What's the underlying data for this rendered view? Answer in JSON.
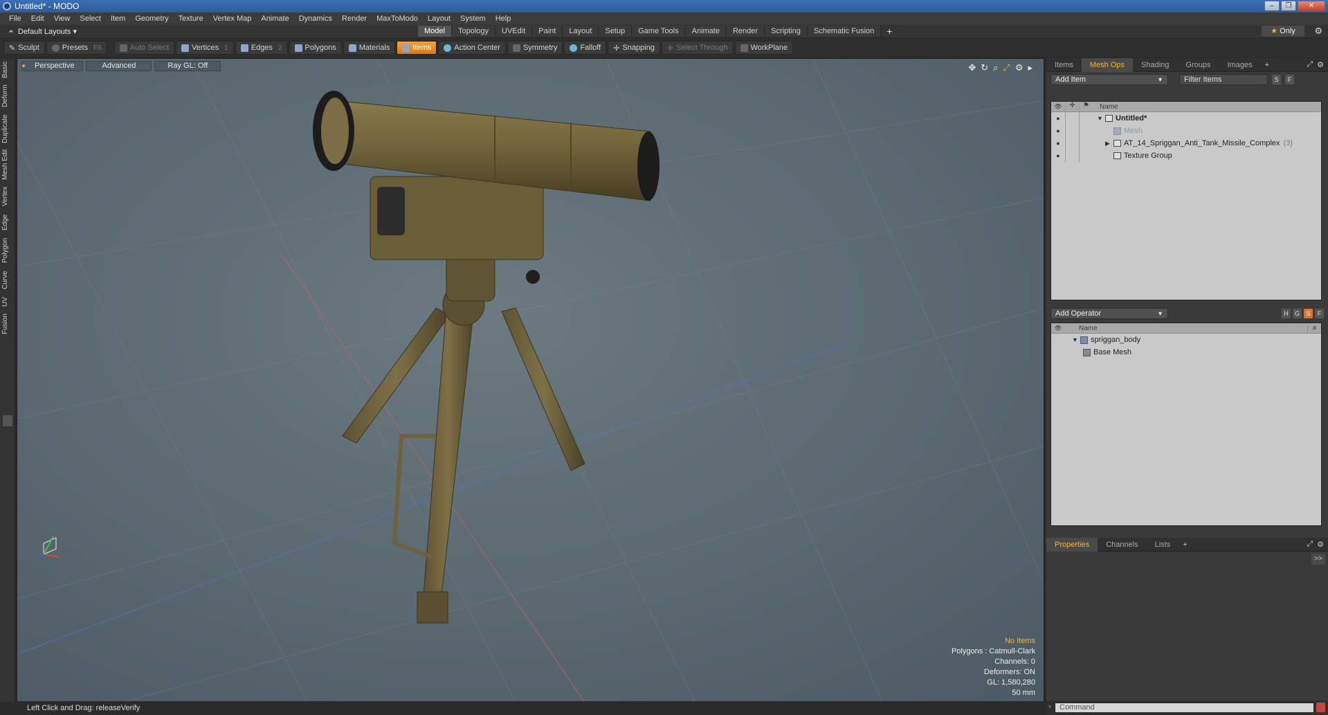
{
  "window": {
    "title": "Untitled* - MODO",
    "controls": [
      "–",
      "❐",
      "✕"
    ]
  },
  "menubar": [
    "File",
    "Edit",
    "View",
    "Select",
    "Item",
    "Geometry",
    "Texture",
    "Vertex Map",
    "Animate",
    "Dynamics",
    "Render",
    "MaxToModo",
    "Layout",
    "System",
    "Help"
  ],
  "layout": {
    "label": "Default Layouts ▾"
  },
  "tabs": [
    {
      "label": "Model",
      "active": true
    },
    {
      "label": "Topology"
    },
    {
      "label": "UVEdit"
    },
    {
      "label": "Paint"
    },
    {
      "label": "Layout"
    },
    {
      "label": "Setup"
    },
    {
      "label": "Game Tools"
    },
    {
      "label": "Animate"
    },
    {
      "label": "Render"
    },
    {
      "label": "Scripting"
    },
    {
      "label": "Schematic Fusion"
    }
  ],
  "tab_add": "+",
  "only_toggle": "Only",
  "toolbar": {
    "sculpt": "Sculpt",
    "presets": "Presets",
    "presets_hk": "F6",
    "auto_select": "Auto Select",
    "vertices": "Vertices",
    "vertices_hk": "1",
    "edges": "Edges",
    "edges_hk": "2",
    "polygons": "Polygons",
    "materials": "Materials",
    "items": "Items",
    "action_center": "Action Center",
    "symmetry": "Symmetry",
    "falloff": "Falloff",
    "snapping": "Snapping",
    "select_through": "Select Through",
    "workplane": "WorkPlane"
  },
  "left_tabs": [
    "Basic",
    "Deform",
    "Duplicate",
    "Mesh Edit",
    "Vertex",
    "Edge",
    "Polygon",
    "Curve",
    "UV",
    "Fusion"
  ],
  "viewport": {
    "perspective": "Perspective",
    "advanced": "Advanced",
    "raygl": "Ray GL: Off",
    "info": {
      "no_items": "No Items",
      "polygons": "Polygons : Catmull-Clark",
      "channels": "Channels: 0",
      "deformers": "Deformers: ON",
      "gl": "GL: 1,580,280",
      "unit": "50 mm"
    }
  },
  "status": "Left Click and Drag:   releaseVerify",
  "panel_top": {
    "tabs": [
      {
        "label": "Items"
      },
      {
        "label": "Mesh Ops",
        "active": true
      },
      {
        "label": "Shading"
      },
      {
        "label": "Groups"
      },
      {
        "label": "Images"
      }
    ],
    "add_item": "Add Item",
    "filter": "Filter Items",
    "btn_s": "S",
    "btn_f": "F",
    "header_name": "Name",
    "rows": {
      "scene": "Untitled*",
      "mesh": "Mesh",
      "model": "AT_14_Spriggan_Anti_Tank_Missile_Complex",
      "model_count": "(3)",
      "texture": "Texture Group"
    }
  },
  "panel_mid": {
    "add_operator": "Add Operator",
    "btn_h": "H",
    "btn_g": "G",
    "btn_s": "S",
    "btn_f": "F",
    "header_name": "Name",
    "header_hash": "#",
    "rows": {
      "body": "spriggan_body",
      "base": "Base Mesh"
    }
  },
  "panel_bottom": {
    "tabs": [
      {
        "label": "Properties",
        "active": true
      },
      {
        "label": "Channels"
      },
      {
        "label": "Lists"
      }
    ],
    "expand": ">>"
  },
  "command": {
    "placeholder": "Command"
  },
  "colors": {
    "accent": "#f0a440",
    "viewport_bg": "#5a6a72",
    "model_olive": "#6b5e3a"
  }
}
